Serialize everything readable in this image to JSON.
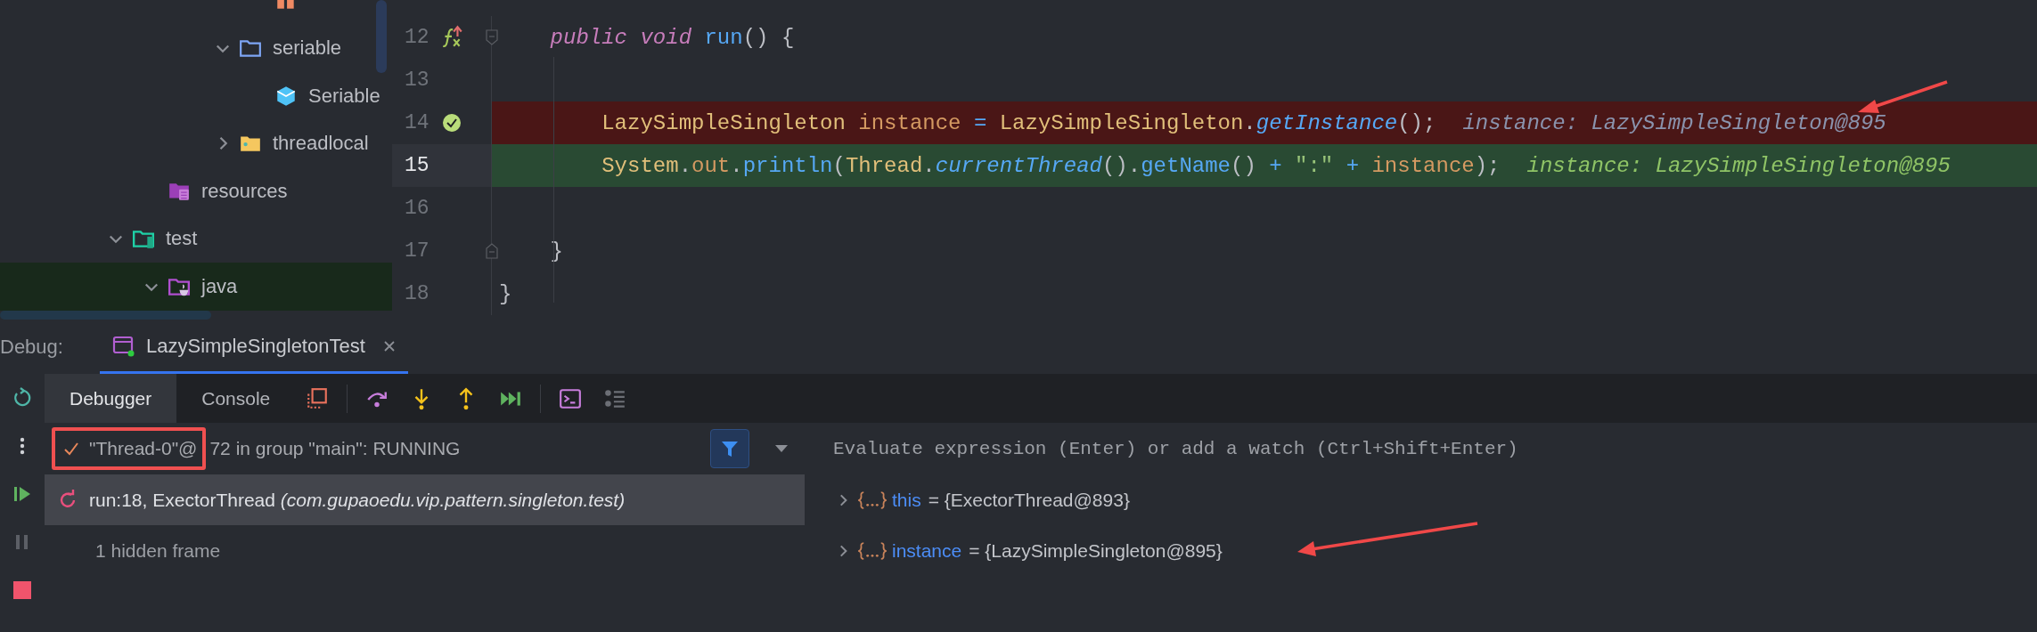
{
  "project_tree": {
    "items": [
      {
        "children": [
          {
            "children": [
              {
                "children": [
                  {
                    "children": [
                      {
                        "kind": "enum",
                        "highlighted": false
                      }
                    ]
                  },
                  {
                    "label": "seriable",
                    "kind": "package",
                    "expanded": true,
                    "highlighted": false,
                    "children": [
                      {
                        "label": "Seriable",
                        "kind": "class",
                        "highlighted": false
                      }
                    ]
                  },
                  {
                    "label": "threadlocal",
                    "kind": "package_marked",
                    "expanded": false,
                    "highlighted": false
                  }
                ]
              }
            ]
          },
          {
            "label": "resources",
            "kind": "resources",
            "highlighted": false
          }
        ]
      },
      {
        "label": "test",
        "kind": "test_root",
        "expanded": true,
        "highlighted": false,
        "children": [
          {
            "label": "java",
            "kind": "source_root",
            "expanded": true,
            "highlighted": true
          }
        ]
      }
    ]
  },
  "editor": {
    "lines": [
      {
        "number": "12",
        "kind": "normal",
        "method_breakpoint": true,
        "fold_start": true,
        "fold_end": false,
        "tokens": [
          {
            "text": "    public ",
            "kind": "keyword"
          },
          {
            "text": "void ",
            "kind": "keyword"
          },
          {
            "text": "run",
            "kind": "call"
          },
          {
            "text": "() {",
            "kind": "punct"
          }
        ]
      },
      {
        "number": "13",
        "kind": "normal",
        "method_breakpoint": false,
        "fold_start": false,
        "fold_end": false
      },
      {
        "number": "14",
        "kind": "breakpoint",
        "method_breakpoint": false,
        "fold_start": false,
        "fold_end": false,
        "tokens": [
          {
            "text": "        LazySimpleSingleton ",
            "kind": "type"
          },
          {
            "text": "instance ",
            "kind": "variable"
          },
          {
            "text": "= ",
            "kind": "operator"
          },
          {
            "text": "LazySimpleSingleton",
            "kind": "type"
          },
          {
            "text": ".",
            "kind": "punct"
          },
          {
            "text": "getInstance",
            "kind": "static_call"
          },
          {
            "text": "();",
            "kind": "punct"
          }
        ],
        "inline_value": "instance: LazySimpleSingleton@895"
      },
      {
        "number": "15",
        "kind": "execution",
        "method_breakpoint": false,
        "fold_start": false,
        "fold_end": false,
        "tokens": [
          {
            "text": "        System",
            "kind": "type"
          },
          {
            "text": ".",
            "kind": "punct"
          },
          {
            "text": "out",
            "kind": "field"
          },
          {
            "text": ".",
            "kind": "punct"
          },
          {
            "text": "println",
            "kind": "call"
          },
          {
            "text": "(",
            "kind": "punct"
          },
          {
            "text": "Thread",
            "kind": "type"
          },
          {
            "text": ".",
            "kind": "punct"
          },
          {
            "text": "currentThread",
            "kind": "static_call"
          },
          {
            "text": "().",
            "kind": "punct"
          },
          {
            "text": "getName",
            "kind": "call"
          },
          {
            "text": "() ",
            "kind": "punct"
          },
          {
            "text": "+ ",
            "kind": "operator"
          },
          {
            "text": "\":\" ",
            "kind": "string"
          },
          {
            "text": "+ ",
            "kind": "operator"
          },
          {
            "text": "instance",
            "kind": "variable"
          },
          {
            "text": ");",
            "kind": "punct"
          }
        ],
        "inline_value": "instance: LazySimpleSingleton@895"
      },
      {
        "number": "16",
        "kind": "normal",
        "method_breakpoint": false,
        "fold_start": false,
        "fold_end": false
      },
      {
        "number": "17",
        "kind": "normal",
        "method_breakpoint": false,
        "fold_start": false,
        "fold_end": true,
        "tokens": [
          {
            "text": "    }",
            "kind": "punct"
          }
        ]
      },
      {
        "number": "18",
        "kind": "normal",
        "method_breakpoint": false,
        "fold_start": false,
        "fold_end": false,
        "tokens": [
          {
            "text": "}",
            "kind": "punct"
          }
        ]
      }
    ]
  },
  "debug": {
    "label": "Debug:",
    "tabs": [
      {
        "label": "LazySimpleSingletonTest",
        "selected": true
      }
    ]
  },
  "toolbar": {
    "tabs": [
      {
        "label": "Debugger",
        "selected": true
      },
      {
        "label": "Console",
        "selected": false
      }
    ]
  },
  "thread": {
    "name": "\"Thread-0\"@",
    "status": "72 in group \"main\": RUNNING",
    "filter_on": true
  },
  "frames": [
    {
      "kind": "frame",
      "text": "run:18, ExectorThread *(com.gupaoedu.vip.pattern.singleton.test)*",
      "selected": true
    },
    {
      "kind": "hidden",
      "text": "1 hidden frame",
      "selected": false
    }
  ],
  "variables": {
    "placeholder": "Evaluate expression (Enter) or add a watch (Ctrl+Shift+Enter)",
    "items": [
      {
        "name": "this",
        "value": "= {ExectorThread@893}",
        "expanded": false
      },
      {
        "name": "instance",
        "value": "= {LazySimpleSingleton@895}",
        "expanded": false
      }
    ]
  }
}
